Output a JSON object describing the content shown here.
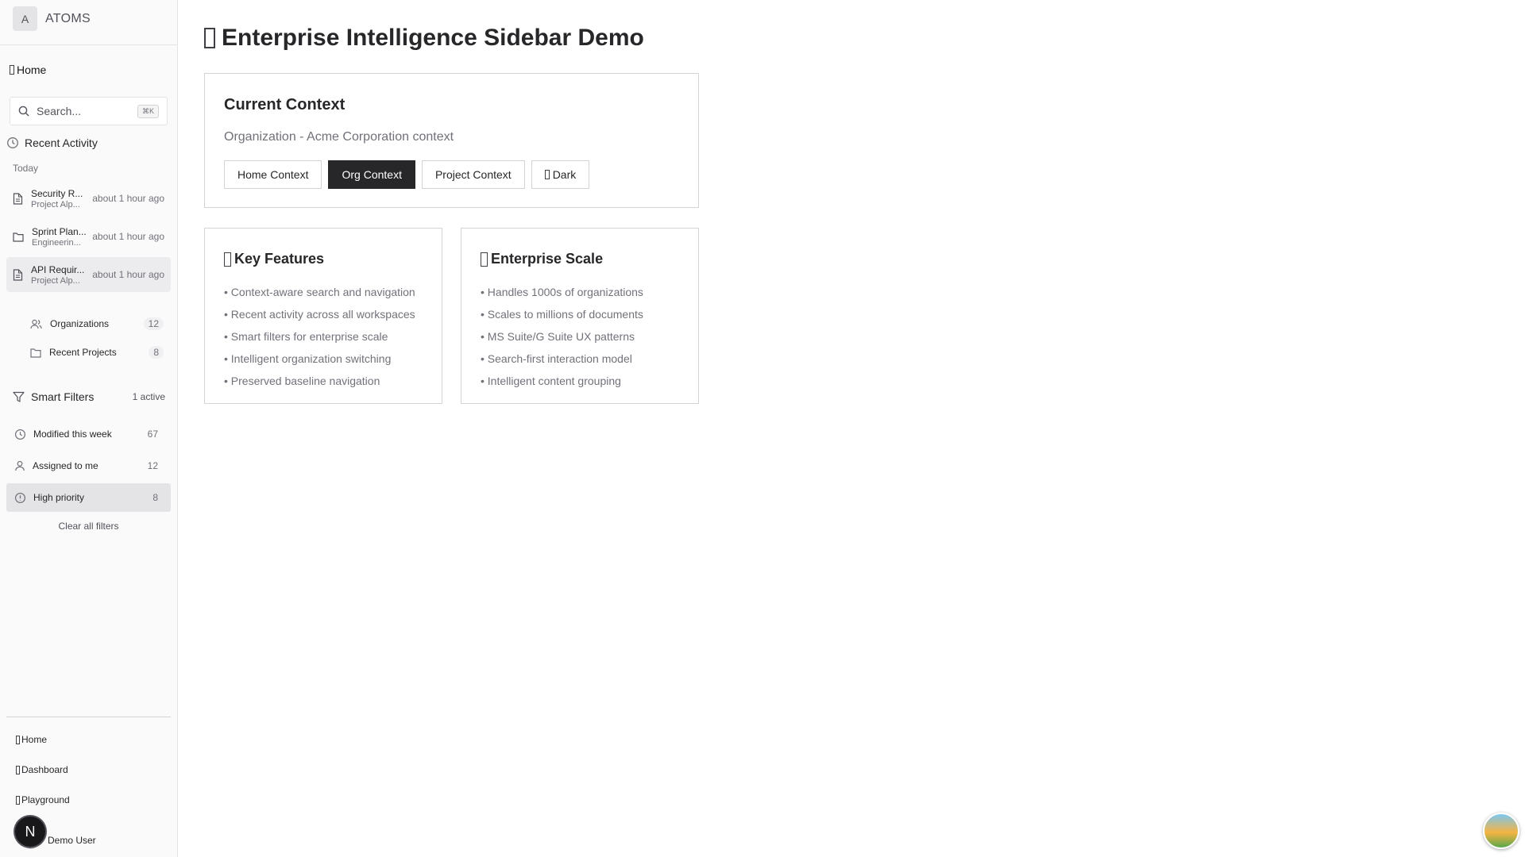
{
  "brand": {
    "initial": "A",
    "name": "ATOMS"
  },
  "sidebar": {
    "home_label": "Home",
    "search": {
      "placeholder": "Search...",
      "shortcut": "⌘K"
    },
    "recent_activity": {
      "title": "Recent Activity",
      "day": "Today",
      "items": [
        {
          "title": "Security R...",
          "subtitle": "Project Alp...",
          "time": "about 1 hour ago",
          "icon": "document-icon",
          "active": false
        },
        {
          "title": "Sprint Plan...",
          "subtitle": "Engineerin...",
          "time": "about 1 hour ago",
          "icon": "folder-icon",
          "active": false
        },
        {
          "title": "API Requir...",
          "subtitle": "Project Alp...",
          "time": "about 1 hour ago",
          "icon": "document-icon",
          "active": true
        }
      ]
    },
    "nav": [
      {
        "label": "Organizations",
        "count": "12",
        "icon": "users-icon"
      },
      {
        "label": "Recent Projects",
        "count": "8",
        "icon": "folder-icon"
      }
    ],
    "smart_filters": {
      "title": "Smart Filters",
      "active_label": "1 active",
      "items": [
        {
          "label": "Modified this week",
          "count": "67",
          "icon": "clock-icon",
          "active": false
        },
        {
          "label": "Assigned to me",
          "count": "12",
          "icon": "user-icon",
          "active": false
        },
        {
          "label": "High priority",
          "count": "8",
          "icon": "alert-circle-icon",
          "active": true
        }
      ],
      "clear_label": "Clear all filters"
    },
    "bottom_links": [
      "Home",
      "Dashboard",
      "Playground"
    ],
    "user_name": "Demo User",
    "badge_letter": "N"
  },
  "main": {
    "title": "Enterprise Intelligence Sidebar Demo",
    "context": {
      "heading": "Current Context",
      "description": "Organization - Acme Corporation context",
      "buttons": [
        "Home Context",
        "Org Context",
        "Project Context",
        "Dark"
      ],
      "active_button": "Org Context"
    },
    "key_features": {
      "heading": "Key Features",
      "items": [
        "• Context-aware search and navigation",
        "• Recent activity across all workspaces",
        "• Smart filters for enterprise scale",
        "• Intelligent organization switching",
        "• Preserved baseline navigation"
      ]
    },
    "enterprise_scale": {
      "heading": "Enterprise Scale",
      "items": [
        "• Handles 1000s of organizations",
        "• Scales to millions of documents",
        "• MS Suite/G Suite UX patterns",
        "• Search-first interaction model",
        "• Intelligent content grouping"
      ]
    }
  },
  "colors": {
    "accent": "#27272a",
    "sidebar_bg": "#fafafa",
    "muted_text": "#71717a",
    "active_bg": "#e4e4e7"
  }
}
